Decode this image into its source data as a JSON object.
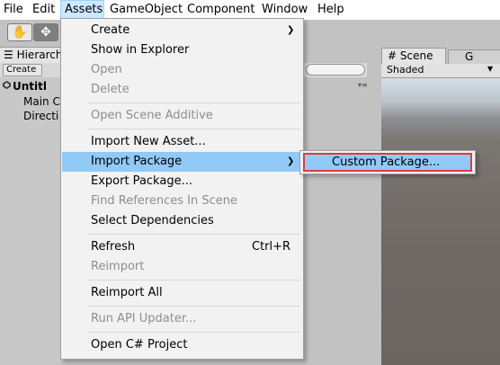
{
  "menubar": {
    "items": [
      "File",
      "Edit",
      "Assets",
      "GameObject",
      "Component",
      "Window",
      "Help"
    ]
  },
  "toolbar": {
    "hand_tool_icon": "hand-icon",
    "move_tool_icon": "move-icon"
  },
  "hierarchy": {
    "tab_label": "Hierarch",
    "create_label": "Create ▾",
    "scene_name": "Untitl",
    "objects": [
      "Main C",
      "Directi"
    ]
  },
  "scene_panel": {
    "scene_tab": "Scene",
    "game_tab": "G",
    "shading_mode": "Shaded"
  },
  "assets_menu": {
    "items": [
      {
        "label": "Create",
        "has_submenu": true,
        "enabled": true
      },
      {
        "label": "Show in Explorer",
        "enabled": true
      },
      {
        "label": "Open",
        "enabled": false
      },
      {
        "label": "Delete",
        "enabled": false
      },
      {
        "label": "Open Scene Additive",
        "enabled": false
      },
      {
        "label": "Import New Asset...",
        "enabled": true
      },
      {
        "label": "Import Package",
        "has_submenu": true,
        "enabled": true,
        "highlighted": true
      },
      {
        "label": "Export Package...",
        "enabled": true
      },
      {
        "label": "Find References In Scene",
        "enabled": false
      },
      {
        "label": "Select Dependencies",
        "enabled": true
      },
      {
        "label": "Refresh",
        "shortcut": "Ctrl+R",
        "enabled": true
      },
      {
        "label": "Reimport",
        "enabled": false
      },
      {
        "label": "Reimport All",
        "enabled": true
      },
      {
        "label": "Run API Updater...",
        "enabled": false
      },
      {
        "label": "Open C# Project",
        "enabled": true
      }
    ]
  },
  "import_package_submenu": {
    "items": [
      {
        "label": "Custom Package...",
        "highlighted": true
      }
    ]
  },
  "colors": {
    "menu_highlight": "#91c9f7",
    "submenu_outline": "#e03a3a",
    "active_menubar_item": "#cce8ff"
  }
}
